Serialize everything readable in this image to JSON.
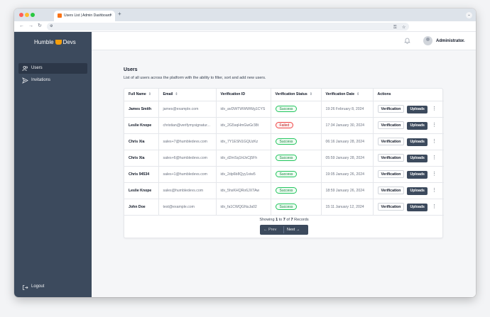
{
  "browser": {
    "tab_title": "Users List | Admin Dashboard",
    "tab_close": "×",
    "new_tab": "+",
    "menu": "⌄",
    "nav": {
      "back": "←",
      "forward": "→",
      "reload": "↻"
    },
    "key_icon_glyph": "⚿",
    "star_glyph": "☆"
  },
  "sidebar": {
    "brand_left": "Humble",
    "brand_right": "Devs",
    "items": [
      {
        "label": "Users",
        "icon": "users-icon",
        "glyph": "👥",
        "active": true
      },
      {
        "label": "Invitations",
        "icon": "paper-plane-icon",
        "glyph": "➢",
        "active": false
      }
    ],
    "logout": {
      "label": "Logout",
      "glyph": "⎋"
    }
  },
  "header": {
    "user_name": "Administrator",
    "bell_glyph": "🔔",
    "chevron": "⌄"
  },
  "page": {
    "title": "Users",
    "description": "List of all users across the platform with the ability to filter, sort and add new users."
  },
  "table": {
    "columns": [
      {
        "label": "Full Name",
        "sortable": true
      },
      {
        "label": "Email",
        "sortable": true
      },
      {
        "label": "Verification ID",
        "sortable": false
      },
      {
        "label": "Verification Status",
        "sortable": true
      },
      {
        "label": "Verification Date",
        "sortable": true
      },
      {
        "label": "Actions",
        "sortable": false
      }
    ],
    "sort_glyph": "⇕",
    "rows": [
      {
        "name": "James Smith",
        "email": "james@example.com",
        "vid": "idv_avDWTWWWWg1CYS",
        "status": "Success",
        "date": "19:26 February 8, 2024"
      },
      {
        "name": "Leslie Knope",
        "email": "christian@verifymysignatur...",
        "vid": "idv_2G5sqHmGwGr38t",
        "status": "Failed",
        "date": "17:34 January 30, 2024"
      },
      {
        "name": "Chris Xia",
        "email": "sales+7@humbledevs.com",
        "vid": "idv_7Y1ESN1GQUzKz",
        "status": "Success",
        "date": "06:16 January 28, 2024"
      },
      {
        "name": "Chris Xia",
        "email": "sales+6@humbledevs.com",
        "vid": "idv_d2mSq1HJxCj5Fh",
        "status": "Success",
        "date": "05:59 January 28, 2024"
      },
      {
        "name": "Chris 94534",
        "email": "sales+1@humbledevs.com",
        "vid": "idv_2dp6b8Qyy1xiw5",
        "status": "Success",
        "date": "19:05 January 26, 2024"
      },
      {
        "name": "Leslie Knope",
        "email": "sales@humbledevs.com",
        "vid": "idv_5hsKHQRo6JXTAw",
        "status": "Success",
        "date": "18:59 January 26, 2024"
      },
      {
        "name": "John Doe",
        "email": "test@example.com",
        "vid": "idv_fa1CWQGNuJa02",
        "status": "Success",
        "date": "15:11 January 12, 2024"
      }
    ],
    "action_verification": "Verification",
    "action_uploads": "Uploads",
    "kebab_glyph": "⋮"
  },
  "pagination": {
    "prefix": "Showing",
    "from": "1",
    "to_word": "to",
    "to": "7",
    "of_word": "of",
    "total": "7",
    "suffix": "Records",
    "prev": "←  Prev",
    "next": "Next  →"
  },
  "colors": {
    "sidebar": "#3c4a5d",
    "success": "#22c55e",
    "failed": "#ef4444",
    "brand_accent": "#f59e0b"
  }
}
